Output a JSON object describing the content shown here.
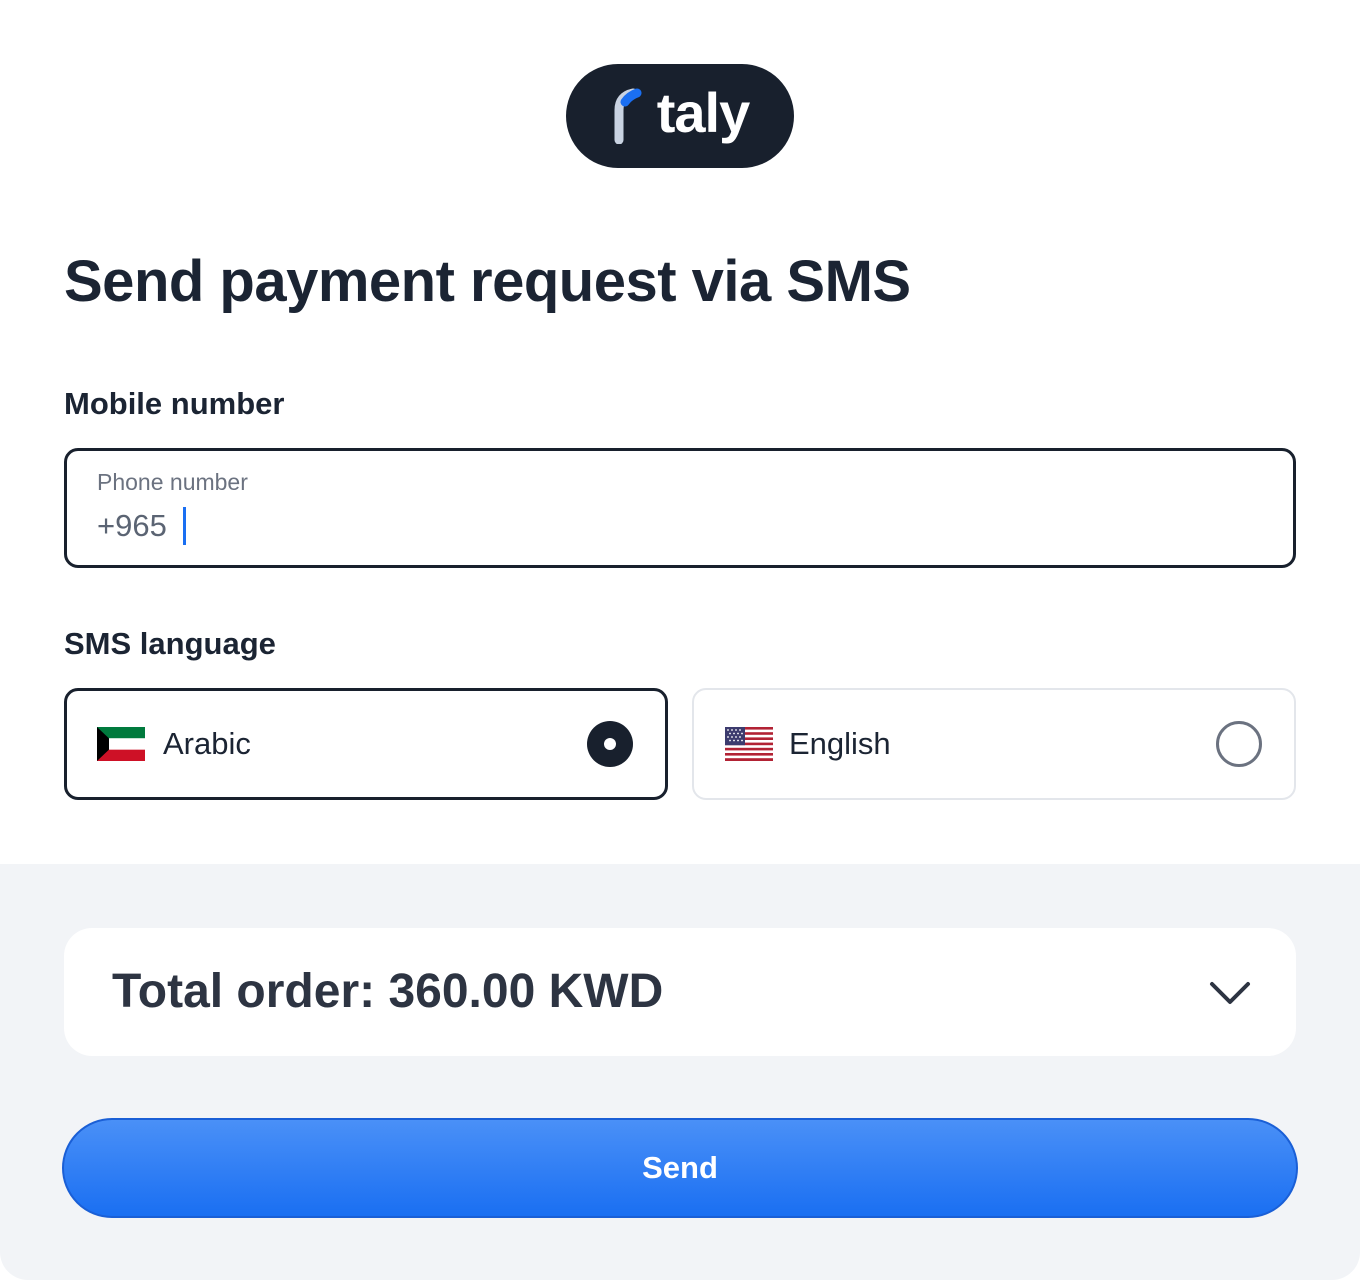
{
  "brand": {
    "name": "taly"
  },
  "page": {
    "title": "Send payment request via SMS"
  },
  "mobile": {
    "label": "Mobile number",
    "placeholder": "Phone number",
    "value": "+965"
  },
  "sms_language": {
    "label": "SMS language",
    "options": [
      {
        "label": "Arabic",
        "flag": "kuwait-flag",
        "selected": true
      },
      {
        "label": "English",
        "flag": "us-flag",
        "selected": false
      }
    ]
  },
  "order": {
    "total_text": "Total order: 360.00 KWD"
  },
  "actions": {
    "send_label": "Send"
  },
  "colors": {
    "dark": "#18202d",
    "accent": "#1a6ff2",
    "footer_bg": "#f2f4f7"
  }
}
